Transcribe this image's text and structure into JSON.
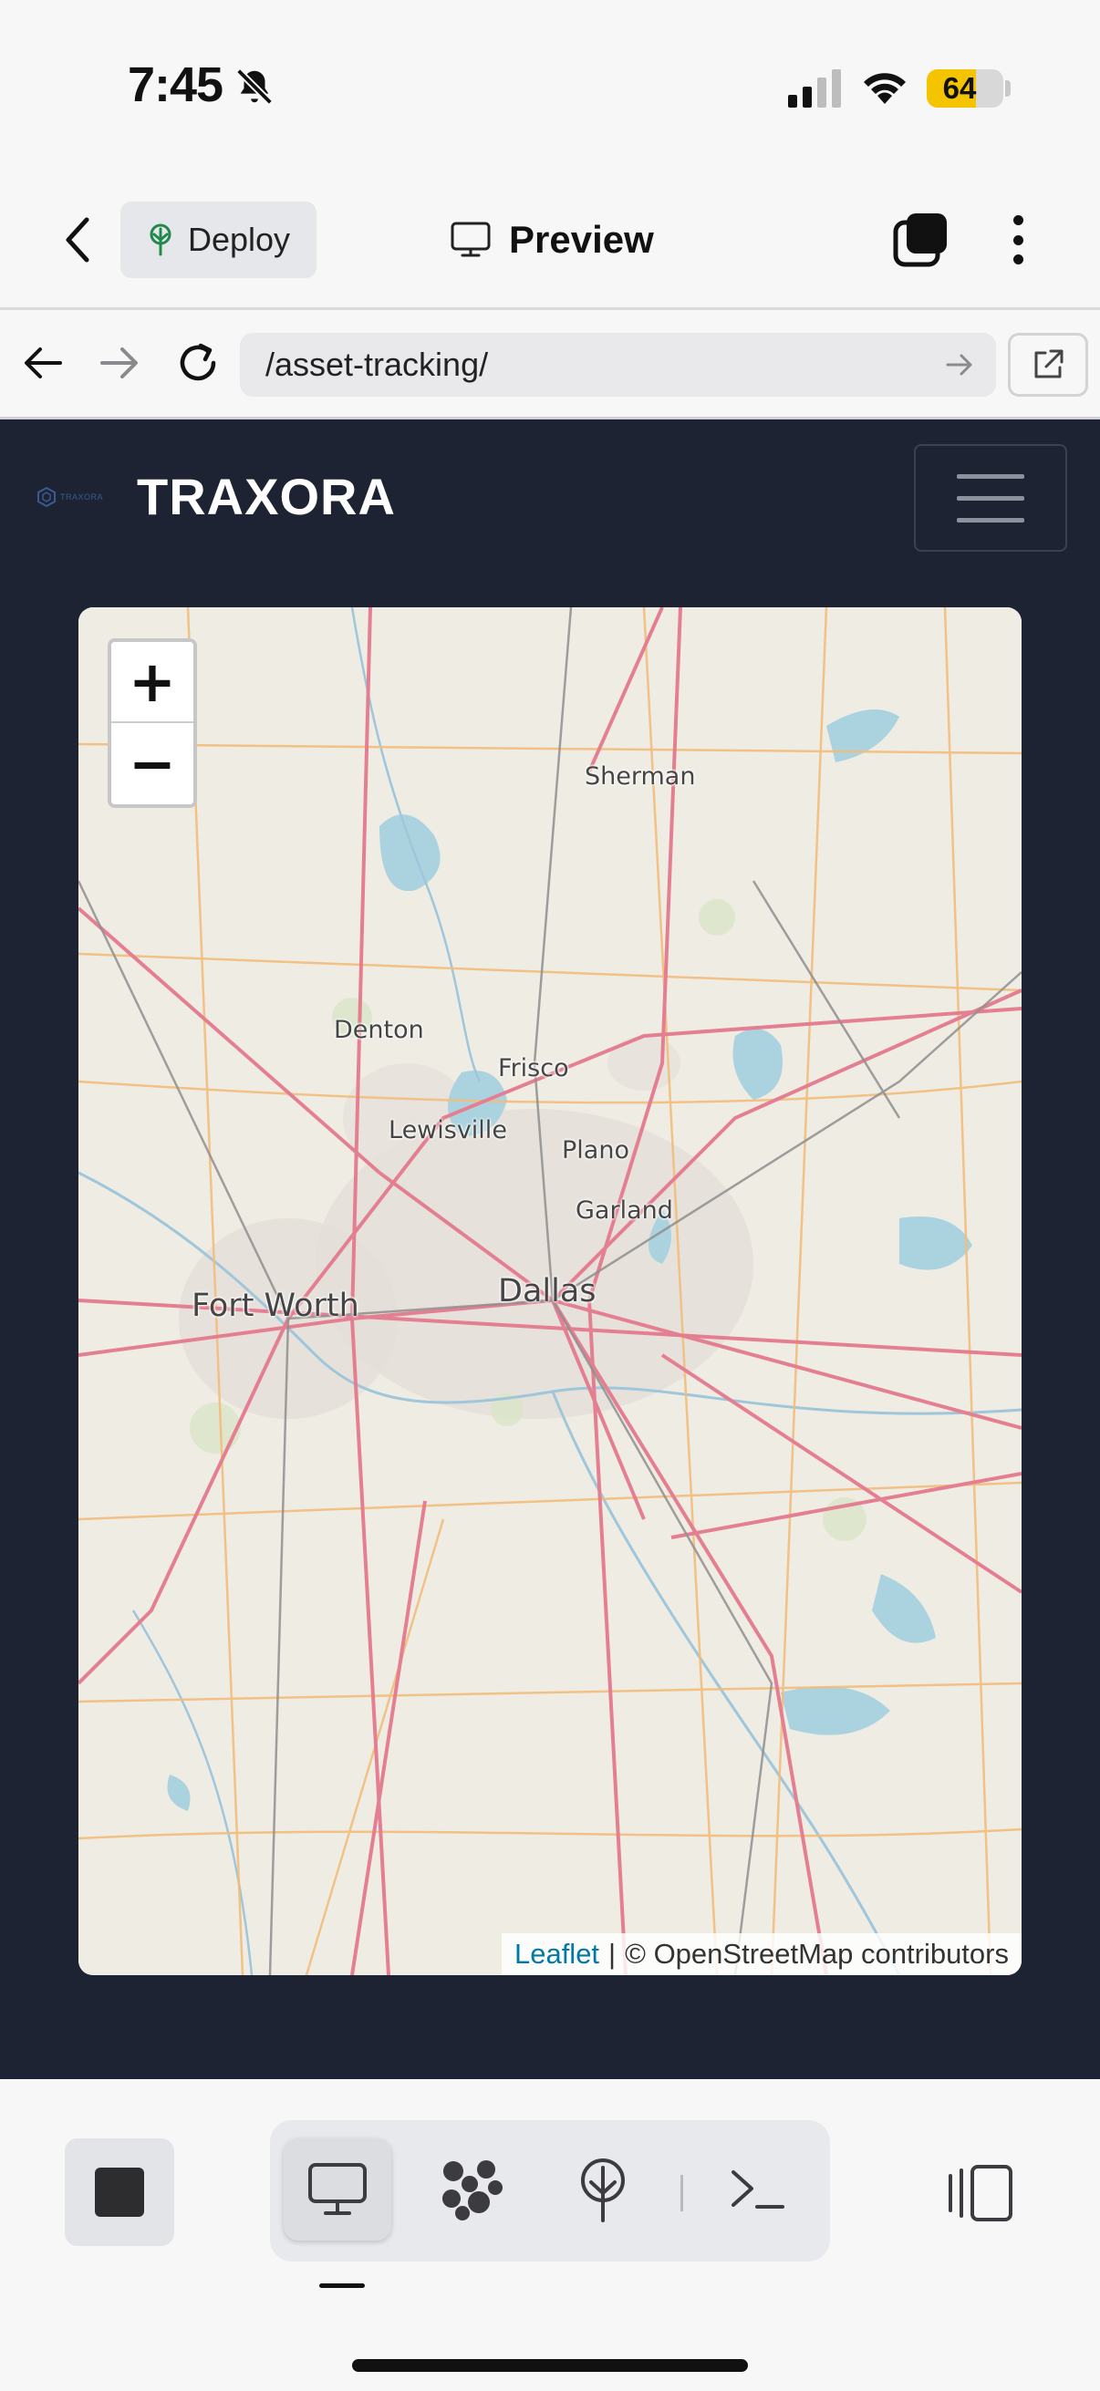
{
  "status_bar": {
    "time": "7:45",
    "battery_level": "64",
    "battery_fraction": 0.64,
    "icons": [
      "bell-slash-icon",
      "cellular-signal-icon",
      "wifi-icon",
      "battery-icon"
    ],
    "battery_color": "#f5c400"
  },
  "app_header": {
    "deploy_label": "Deploy",
    "preview_label": "Preview",
    "icons": [
      "chevron-left-icon",
      "deploy-tree-icon",
      "monitor-icon",
      "tabs-icon",
      "more-vertical-icon"
    ]
  },
  "browser": {
    "url": "/asset-tracking/",
    "icons": [
      "arrow-left-icon",
      "arrow-right-icon",
      "reload-icon",
      "go-arrow-icon",
      "open-external-icon"
    ]
  },
  "site": {
    "brand": "TRAXORA",
    "logo_text": "TRAXORA",
    "background": "#1d2333"
  },
  "map": {
    "zoom_in_label": "+",
    "zoom_out_label": "−",
    "cities": {
      "sherman": "Sherman",
      "denton": "Denton",
      "frisco": "Frisco",
      "lewisville": "Lewisville",
      "plano": "Plano",
      "garland": "Garland",
      "fort_worth": "Fort Worth",
      "dallas": "Dallas"
    },
    "attribution": {
      "leaflet": "Leaflet",
      "separator": "|",
      "osm": "© OpenStreetMap contributors"
    }
  },
  "toolbar": {
    "items": [
      "stop-icon",
      "monitor-icon",
      "integrations-icon",
      "deploy-tree-icon",
      "terminal-icon",
      "sidebar-toggle-icon"
    ],
    "active_item": "monitor-icon"
  }
}
